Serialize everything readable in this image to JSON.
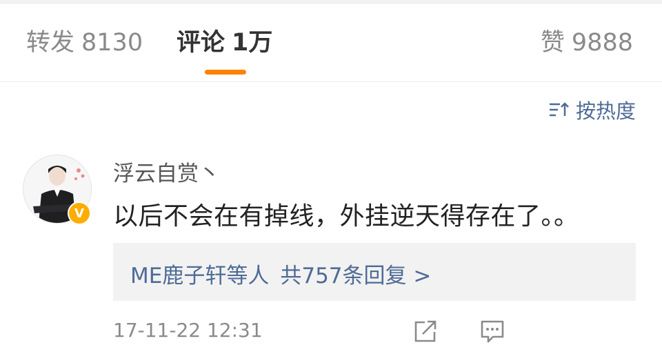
{
  "tabs": {
    "forward": {
      "label": "转发",
      "count": "8130"
    },
    "comment": {
      "label": "评论",
      "count": "1万"
    },
    "like": {
      "label": "赞",
      "count": "9888"
    }
  },
  "sort": {
    "label": "按热度",
    "icon": "sort-icon"
  },
  "comment": {
    "username": "浮云自赏丶",
    "text": "以后不会在有掉线，外挂逆天得存在了。。",
    "verified_icon": "verified-badge",
    "replies": {
      "users": "ME鹿子轩等人",
      "summary": "共757条回复 >"
    },
    "timestamp": "17-11-22 12:31",
    "actions": [
      "share-icon",
      "comment-icon"
    ]
  },
  "colors": {
    "accent": "#ff8200",
    "link": "#4e6b96",
    "verified": "#ffad00"
  }
}
